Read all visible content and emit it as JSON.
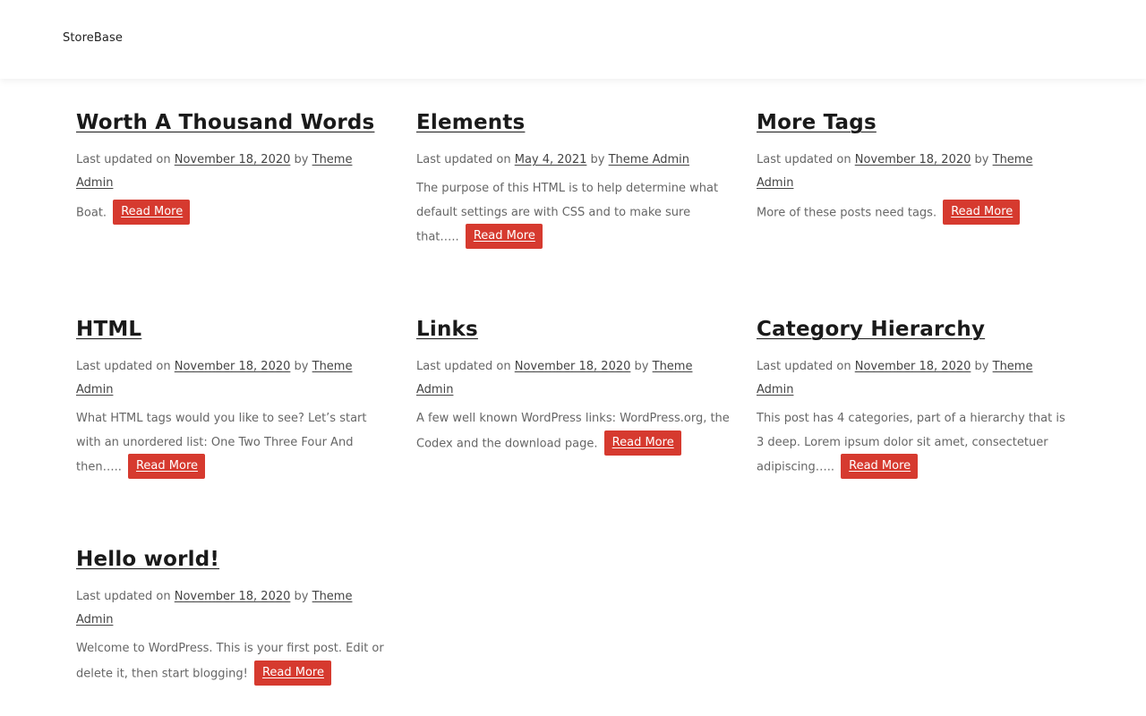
{
  "site": {
    "title": "StoreBase"
  },
  "colors": {
    "accent": "#d63a2f",
    "text": "#666666",
    "heading": "#1a1a1a"
  },
  "meta_labels": {
    "updated": "Last updated on",
    "by": "by"
  },
  "read_more": "Read More",
  "posts": [
    {
      "title": "Worth A Thousand Words",
      "date": "November 18, 2020",
      "author": "Theme Admin",
      "excerpt": "Boat."
    },
    {
      "title": "Elements",
      "date": "May 4, 2021",
      "author": "Theme Admin",
      "excerpt": "The purpose of this HTML is to help determine what default settings are with CSS and to make sure that….."
    },
    {
      "title": "More Tags",
      "date": "November 18, 2020",
      "author": "Theme Admin",
      "excerpt": "More of these posts need tags."
    },
    {
      "title": "HTML",
      "date": "November 18, 2020",
      "author": "Theme Admin",
      "excerpt": "What HTML tags would you like to see? Let’s start with an unordered list: One Two Three Four And then….."
    },
    {
      "title": "Links",
      "date": "November 18, 2020",
      "author": "Theme Admin",
      "excerpt": "A few well known WordPress links: WordPress.org, the Codex and the download page."
    },
    {
      "title": "Category Hierarchy",
      "date": "November 18, 2020",
      "author": "Theme Admin",
      "excerpt": "This post has 4 categories, part of a hierarchy that is 3 deep. Lorem ipsum dolor sit amet, consectetuer adipiscing….."
    },
    {
      "title": "Hello world!",
      "date": "November 18, 2020",
      "author": "Theme Admin",
      "excerpt": "Welcome to WordPress. This is your first post. Edit or delete it, then start blogging!"
    }
  ]
}
